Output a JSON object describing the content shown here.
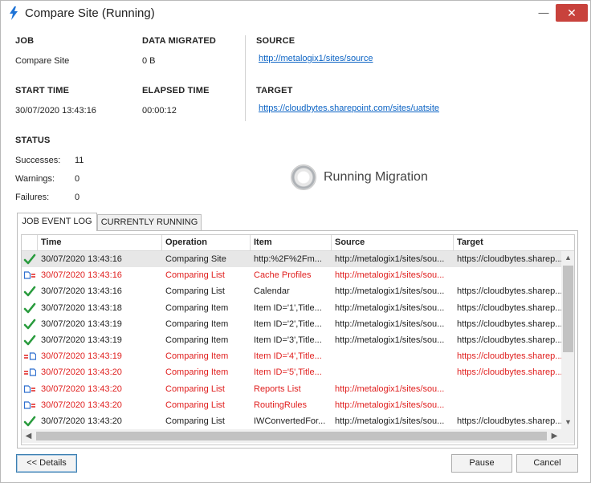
{
  "window": {
    "title": "Compare Site (Running)",
    "minimize_glyph": "—",
    "close_glyph": "✕"
  },
  "summary": {
    "job_label": "JOB",
    "job_value": "Compare Site",
    "data_migrated_label": "DATA MIGRATED",
    "data_migrated_value": "0 B",
    "source_label": "SOURCE",
    "source_url": "http://metalogix1/sites/source",
    "start_time_label": "START TIME",
    "start_time_value": "30/07/2020 13:43:16",
    "elapsed_time_label": "ELAPSED TIME",
    "elapsed_time_value": "00:00:12",
    "target_label": "TARGET",
    "target_url": "https://cloudbytes.sharepoint.com/sites/uatsite"
  },
  "status": {
    "label": "STATUS",
    "successes_label": "Successes:",
    "successes_value": "11",
    "warnings_label": "Warnings:",
    "warnings_value": "0",
    "failures_label": "Failures:",
    "failures_value": "0"
  },
  "running_text": "Running Migration",
  "tabs": [
    {
      "label": "JOB EVENT LOG",
      "active": true
    },
    {
      "label": "CURRENTLY RUNNING",
      "active": false
    }
  ],
  "grid": {
    "columns": [
      "Time",
      "Operation",
      "Item",
      "Source",
      "Target"
    ],
    "rows": [
      {
        "icon": "success-check-icon",
        "style": "normal",
        "selected": true,
        "time": "30/07/2020 13:43:16",
        "operation": "Comparing Site",
        "item": "http:%2F%2Fm...",
        "source": "http://metalogix1/sites/sou...",
        "target": "https://cloudbytes.sharep..."
      },
      {
        "icon": "source-only-icon",
        "style": "warn",
        "selected": false,
        "time": "30/07/2020 13:43:16",
        "operation": "Comparing List",
        "item": "Cache Profiles",
        "source": "http://metalogix1/sites/sou...",
        "target": ""
      },
      {
        "icon": "success-check-icon",
        "style": "normal",
        "selected": false,
        "time": "30/07/2020 13:43:16",
        "operation": "Comparing List",
        "item": "Calendar",
        "source": "http://metalogix1/sites/sou...",
        "target": "https://cloudbytes.sharep..."
      },
      {
        "icon": "success-check-icon",
        "style": "normal",
        "selected": false,
        "time": "30/07/2020 13:43:18",
        "operation": "Comparing Item",
        "item": "Item ID='1',Title...",
        "source": "http://metalogix1/sites/sou...",
        "target": "https://cloudbytes.sharep..."
      },
      {
        "icon": "success-check-icon",
        "style": "normal",
        "selected": false,
        "time": "30/07/2020 13:43:19",
        "operation": "Comparing Item",
        "item": "Item ID='2',Title...",
        "source": "http://metalogix1/sites/sou...",
        "target": "https://cloudbytes.sharep..."
      },
      {
        "icon": "success-check-icon",
        "style": "normal",
        "selected": false,
        "time": "30/07/2020 13:43:19",
        "operation": "Comparing Item",
        "item": "Item ID='3',Title...",
        "source": "http://metalogix1/sites/sou...",
        "target": "https://cloudbytes.sharep..."
      },
      {
        "icon": "target-only-icon",
        "style": "warn",
        "selected": false,
        "time": "30/07/2020 13:43:19",
        "operation": "Comparing Item",
        "item": "Item ID='4',Title...",
        "source": "",
        "target": "https://cloudbytes.sharep..."
      },
      {
        "icon": "target-only-icon",
        "style": "warn",
        "selected": false,
        "time": "30/07/2020 13:43:20",
        "operation": "Comparing Item",
        "item": "Item ID='5',Title...",
        "source": "",
        "target": "https://cloudbytes.sharep..."
      },
      {
        "icon": "source-only-icon",
        "style": "warn",
        "selected": false,
        "time": "30/07/2020 13:43:20",
        "operation": "Comparing List",
        "item": "Reports List",
        "source": "http://metalogix1/sites/sou...",
        "target": ""
      },
      {
        "icon": "source-only-icon",
        "style": "warn",
        "selected": false,
        "time": "30/07/2020 13:43:20",
        "operation": "Comparing List",
        "item": "RoutingRules",
        "source": "http://metalogix1/sites/sou...",
        "target": ""
      },
      {
        "icon": "success-check-icon",
        "style": "normal",
        "selected": false,
        "time": "30/07/2020 13:43:20",
        "operation": "Comparing List",
        "item": "IWConvertedFor...",
        "source": "http://metalogix1/sites/sou...",
        "target": "https://cloudbytes.sharep..."
      }
    ]
  },
  "buttons": {
    "details": "<< Details",
    "pause": "Pause",
    "cancel": "Cancel"
  },
  "colors": {
    "warn_text": "#e0201f",
    "link": "#0b63c4",
    "success": "#2a9b3e",
    "close_button": "#c8423c",
    "icon_blue": "#2f6fcf"
  }
}
